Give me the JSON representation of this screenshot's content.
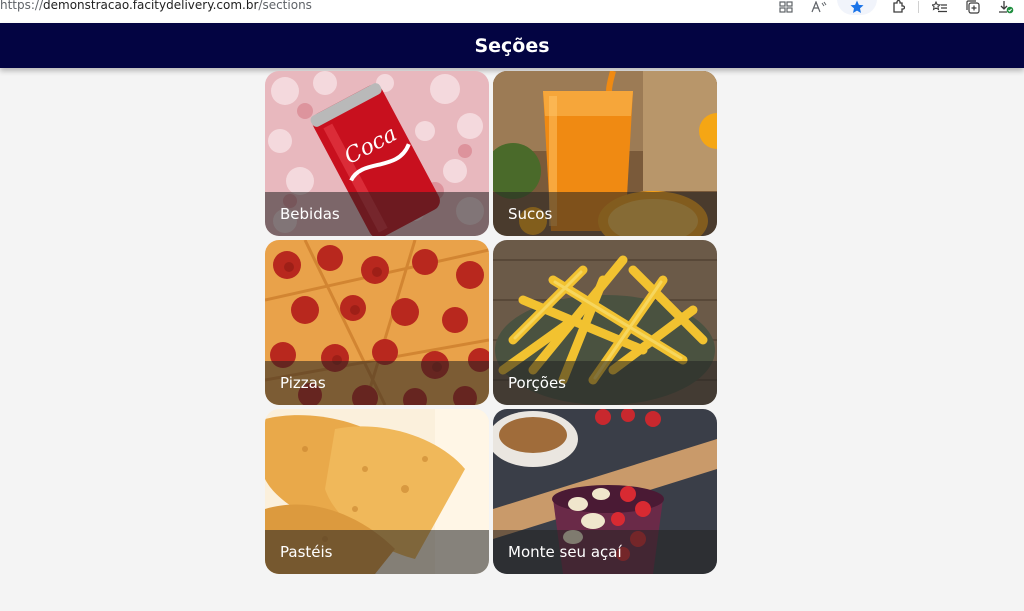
{
  "browser": {
    "url_scheme": "https://",
    "url_host": "demonstracao.facitydelivery.com.br",
    "url_path": "/sections",
    "accent_color": "#1a73e8"
  },
  "header": {
    "title": "Seções",
    "background_color": "#030442"
  },
  "sections": [
    {
      "label": "Bebidas",
      "icon": "soda-can-image"
    },
    {
      "label": "Sucos",
      "icon": "orange-juice-image"
    },
    {
      "label": "Pizzas",
      "icon": "pepperoni-pizza-image"
    },
    {
      "label": "Porções",
      "icon": "french-fries-image"
    },
    {
      "label": "Pastéis",
      "icon": "pastel-image"
    },
    {
      "label": "Monte seu açaí",
      "icon": "acai-bowl-image"
    }
  ]
}
